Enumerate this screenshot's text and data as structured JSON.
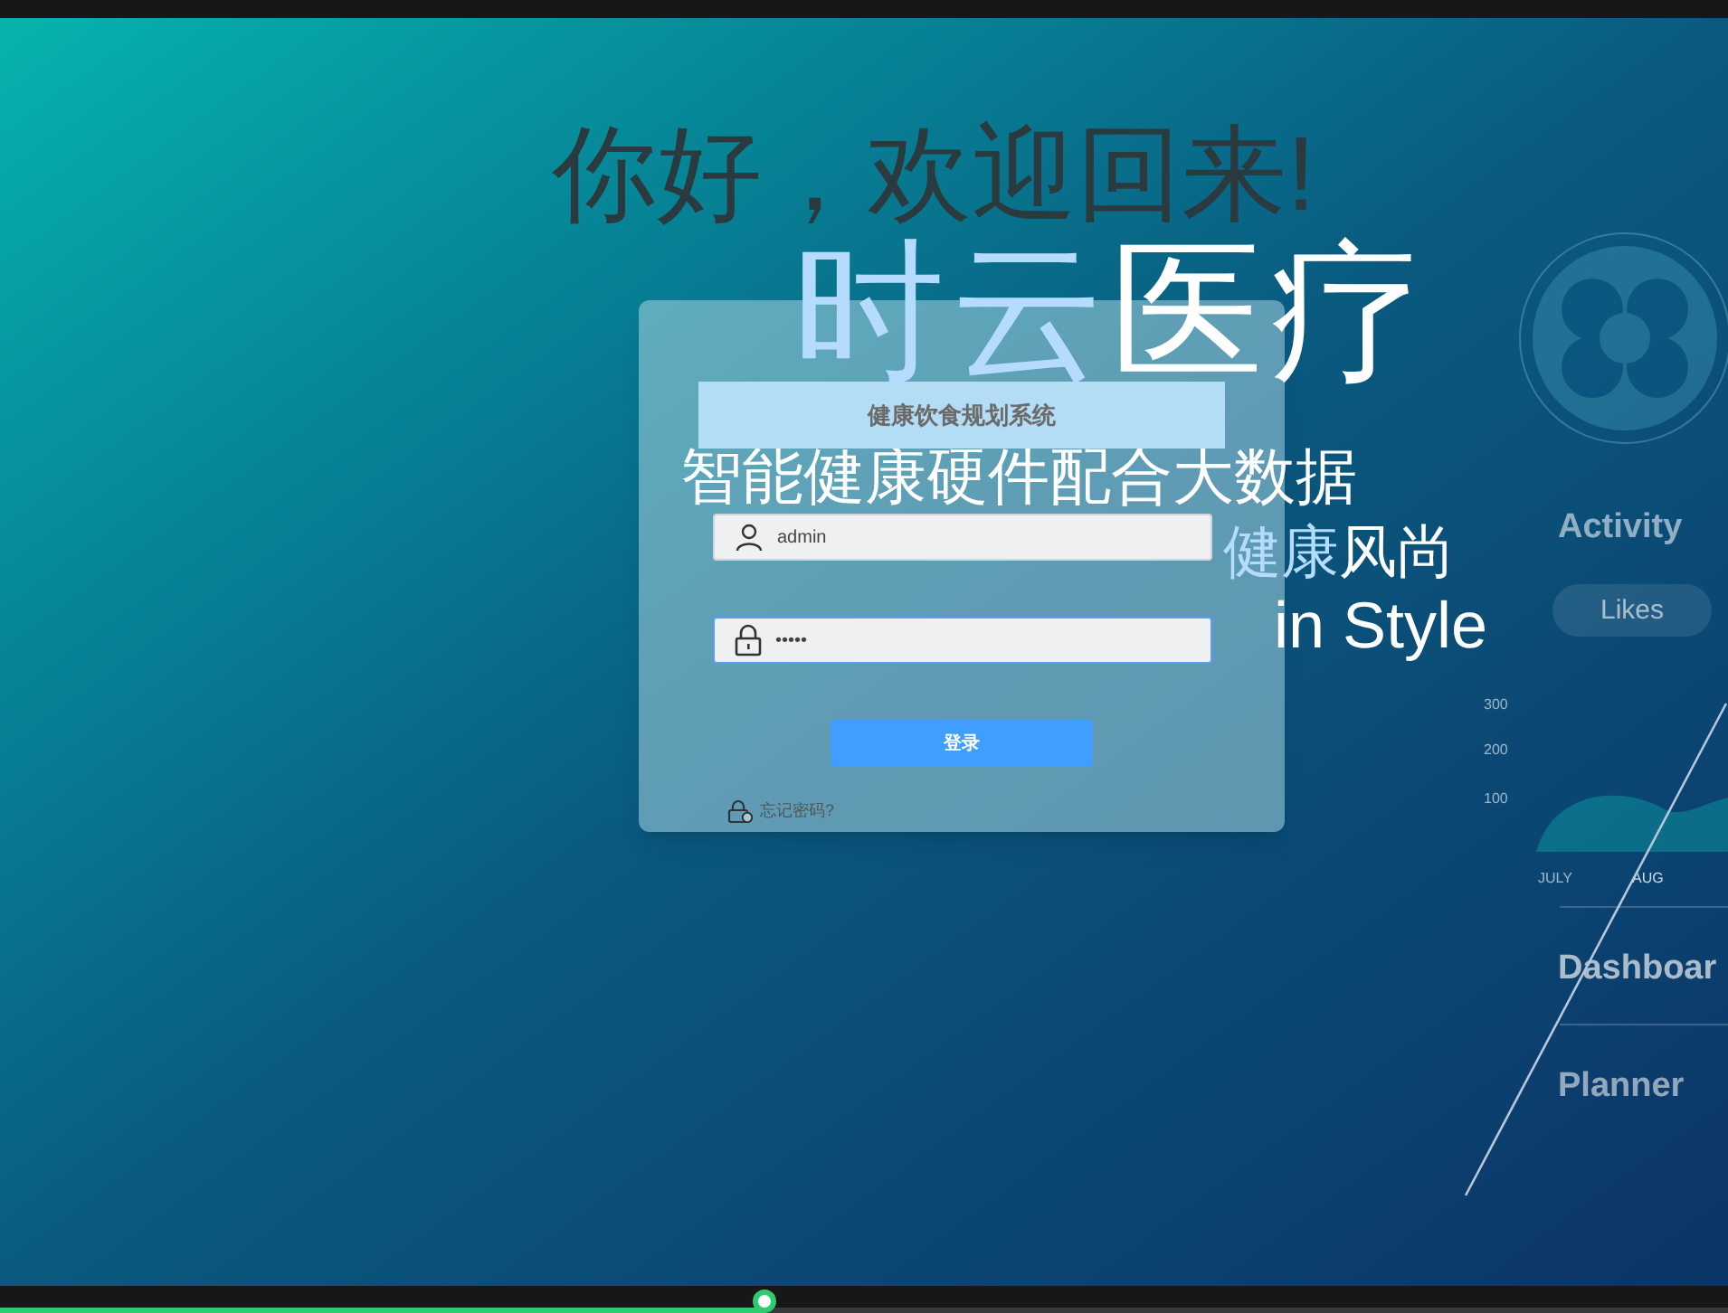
{
  "greeting": "你好，欢迎回来!",
  "hero": {
    "brand": [
      {
        "text": "时云",
        "kind": "accent"
      },
      {
        "text": "医疗",
        "kind": "plain"
      }
    ],
    "tagline": "智能健康硬件配合大数据",
    "motto": [
      {
        "text": "健康",
        "kind": "accent"
      },
      {
        "text": "风尚",
        "kind": "plain"
      }
    ],
    "english": "in Style"
  },
  "dashboard_art": {
    "heading": "Activity",
    "pill": "Likes",
    "yticks": [
      "300",
      "200",
      "100"
    ],
    "months": [
      "JULY",
      "AUG"
    ],
    "menu": [
      "Dashboar",
      "Planner"
    ]
  },
  "login": {
    "system_name": "健康饮食规划系统",
    "username": {
      "value": "admin"
    },
    "password": {
      "value": "•••••",
      "focused": true
    },
    "submit": "登录",
    "forgot": "忘记密码?"
  },
  "player_bar": {
    "level": 0.443
  }
}
